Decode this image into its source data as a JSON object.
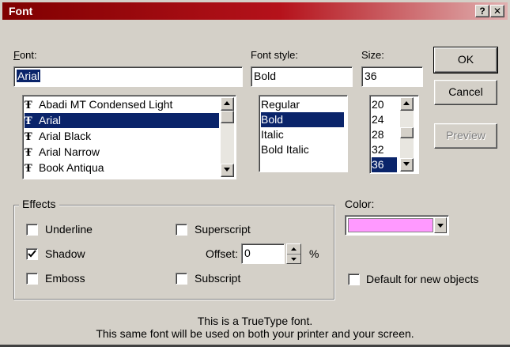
{
  "window": {
    "title": "Font",
    "help_label": "?",
    "close_label": "✕"
  },
  "font": {
    "label": "Font:",
    "value": "Arial",
    "items": [
      {
        "name": "Abadi MT Condensed Light",
        "icon": "truetype-icon",
        "selected": false
      },
      {
        "name": "Arial",
        "icon": "truetype-icon",
        "selected": true
      },
      {
        "name": "Arial Black",
        "icon": "truetype-icon",
        "selected": false
      },
      {
        "name": "Arial Narrow",
        "icon": "truetype-icon",
        "selected": false
      },
      {
        "name": "Book Antiqua",
        "icon": "truetype-icon",
        "selected": false
      }
    ],
    "icon_glyph": "Ŧ"
  },
  "style": {
    "label": "Font style:",
    "value": "Bold",
    "items": [
      "Regular",
      "Bold",
      "Italic",
      "Bold Italic"
    ],
    "selected_index": 1
  },
  "size": {
    "label": "Size:",
    "value": "36",
    "items": [
      "20",
      "24",
      "28",
      "32",
      "36"
    ],
    "selected_index": 4
  },
  "buttons": {
    "ok": "OK",
    "cancel": "Cancel",
    "preview": "Preview"
  },
  "effects": {
    "title": "Effects",
    "underline": {
      "label": "Underline",
      "checked": false
    },
    "shadow": {
      "label": "Shadow",
      "checked": true
    },
    "emboss": {
      "label": "Emboss",
      "checked": false
    },
    "superscript": {
      "label": "Superscript",
      "checked": false
    },
    "subscript": {
      "label": "Subscript",
      "checked": false
    },
    "offset": {
      "label": "Offset:",
      "value": "0",
      "unit": "%"
    }
  },
  "color": {
    "label": "Color:",
    "value": "#ff99ff"
  },
  "default_for_new": {
    "label": "Default for new objects",
    "checked": false
  },
  "info": {
    "line1": "This is a TrueType font.",
    "line2": "This same font will be used on both your printer and your screen."
  }
}
